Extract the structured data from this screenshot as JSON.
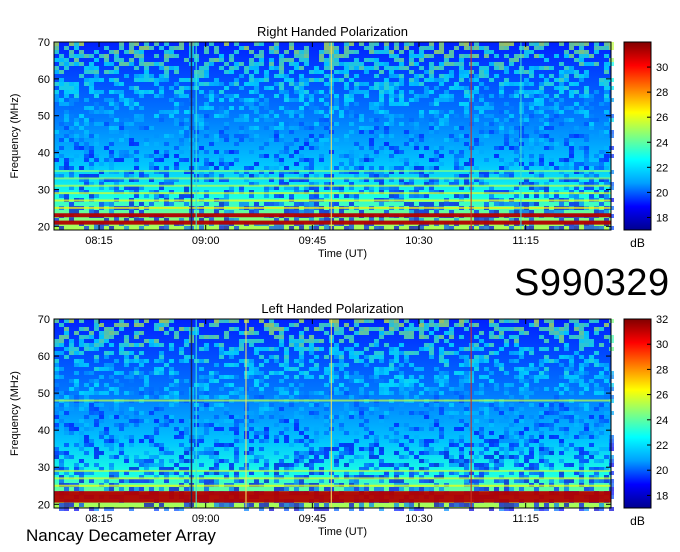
{
  "figure": {
    "observation_code": "S990329",
    "observatory": "Nancay Decameter Array",
    "colors": {
      "colormap": [
        "#00008f",
        "#0000ff",
        "#00a0ff",
        "#00ffff",
        "#80ff80",
        "#ffff00",
        "#ff8000",
        "#ff0000",
        "#800000"
      ],
      "frame": "#000000",
      "background": "#ffffff"
    }
  },
  "chart_data": [
    {
      "type": "heatmap",
      "title": "Right Handed Polarization",
      "xlabel": "Time (UT)",
      "ylabel": "Frequency (MHz)",
      "colorbar_label": "dB",
      "x_ticks": [
        "08:15",
        "09:00",
        "09:45",
        "10:30",
        "11:15"
      ],
      "x_tick_minutes": [
        495,
        540,
        585,
        630,
        675
      ],
      "xlim_minutes": [
        476,
        711
      ],
      "y_ticks": [
        20,
        30,
        40,
        50,
        60,
        70
      ],
      "ylim": [
        19,
        70
      ],
      "colorbar_ticks": [
        18,
        20,
        22,
        24,
        26,
        28,
        30
      ],
      "colorbar_range": [
        17,
        32
      ],
      "vertical_lines": [
        {
          "minute": 534,
          "kind": "dark"
        },
        {
          "minute": 536,
          "kind": "cyan"
        },
        {
          "minute": 593,
          "kind": "yellow"
        },
        {
          "minute": 652,
          "kind": "red"
        },
        {
          "minute": 673,
          "kind": "cyan"
        }
      ],
      "horizontal_bands_mhz": [
        21,
        23,
        25,
        27,
        29,
        31,
        33,
        35
      ],
      "noise_seed": 7
    },
    {
      "type": "heatmap",
      "title": "Left Handed Polarization",
      "xlabel": "Time (UT)",
      "ylabel": "Frequency (MHz)",
      "colorbar_label": "dB",
      "x_ticks": [
        "08:15",
        "09:00",
        "09:45",
        "10:30",
        "11:15"
      ],
      "x_tick_minutes": [
        495,
        540,
        585,
        630,
        675
      ],
      "xlim_minutes": [
        476,
        711
      ],
      "y_ticks": [
        20,
        30,
        40,
        50,
        60,
        70
      ],
      "ylim": [
        19,
        70
      ],
      "colorbar_ticks": [
        18,
        20,
        22,
        24,
        26,
        28,
        30,
        32
      ],
      "colorbar_range": [
        17,
        32
      ],
      "vertical_lines": [
        {
          "minute": 534,
          "kind": "dark"
        },
        {
          "minute": 536,
          "kind": "cyan"
        },
        {
          "minute": 557,
          "kind": "yellow"
        },
        {
          "minute": 593,
          "kind": "yellow"
        },
        {
          "minute": 652,
          "kind": "red"
        }
      ],
      "horizontal_bands_mhz": [
        21,
        22,
        23,
        25,
        27,
        29,
        48
      ],
      "noise_seed": 13
    }
  ]
}
